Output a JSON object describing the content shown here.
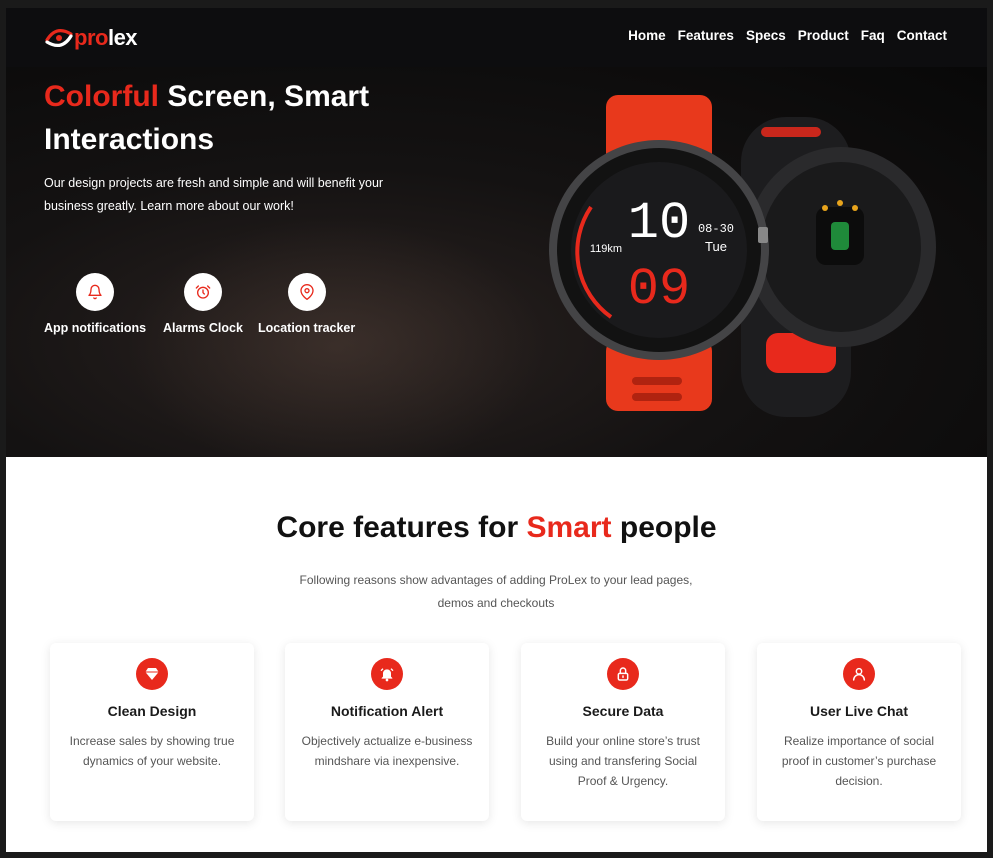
{
  "nav": {
    "logo_pro": "pro",
    "logo_lex": "lex",
    "links": [
      "Home",
      "Features",
      "Specs",
      "Product",
      "Faq",
      "Contact"
    ]
  },
  "hero": {
    "title_accent": "Colorful",
    "title_rest_line1": " Screen, Smart",
    "title_line2": "Interactions",
    "description": "Our design projects are fresh and simple and will benefit your business greatly. Learn more about our work!",
    "features": [
      {
        "label": "App notifications",
        "icon": "bell-icon"
      },
      {
        "label": "Alarms Clock",
        "icon": "alarm-clock-icon"
      },
      {
        "label": "Location tracker",
        "icon": "location-pin-icon"
      }
    ],
    "watch": {
      "hour": "10",
      "minute": "09",
      "date": "08-30",
      "day": "Tue",
      "distance": "119km"
    }
  },
  "features": {
    "title_pre": "Core features for ",
    "title_accent": "Smart",
    "title_post": " people",
    "subtitle": "Following reasons show advantages of adding ProLex to your lead pages, demos and checkouts",
    "cards": [
      {
        "title": "Clean Design",
        "text": "Increase sales by showing true dynamics of your website.",
        "icon": "diamond-icon"
      },
      {
        "title": "Notification Alert",
        "text": "Objectively actualize e-business mindshare via inexpensive.",
        "icon": "alarm-bell-icon"
      },
      {
        "title": "Secure Data",
        "text": "Build your online store’s trust using and transfering Social Proof & Urgency.",
        "icon": "lock-icon"
      },
      {
        "title": "User Live Chat",
        "text": "Realize importance of social proof in customer’s purchase decision.",
        "icon": "user-icon"
      }
    ]
  },
  "colors": {
    "accent": "#e8291c",
    "nav_bg": "#0d0d0f",
    "hero_bg": "#0c0b0b"
  }
}
